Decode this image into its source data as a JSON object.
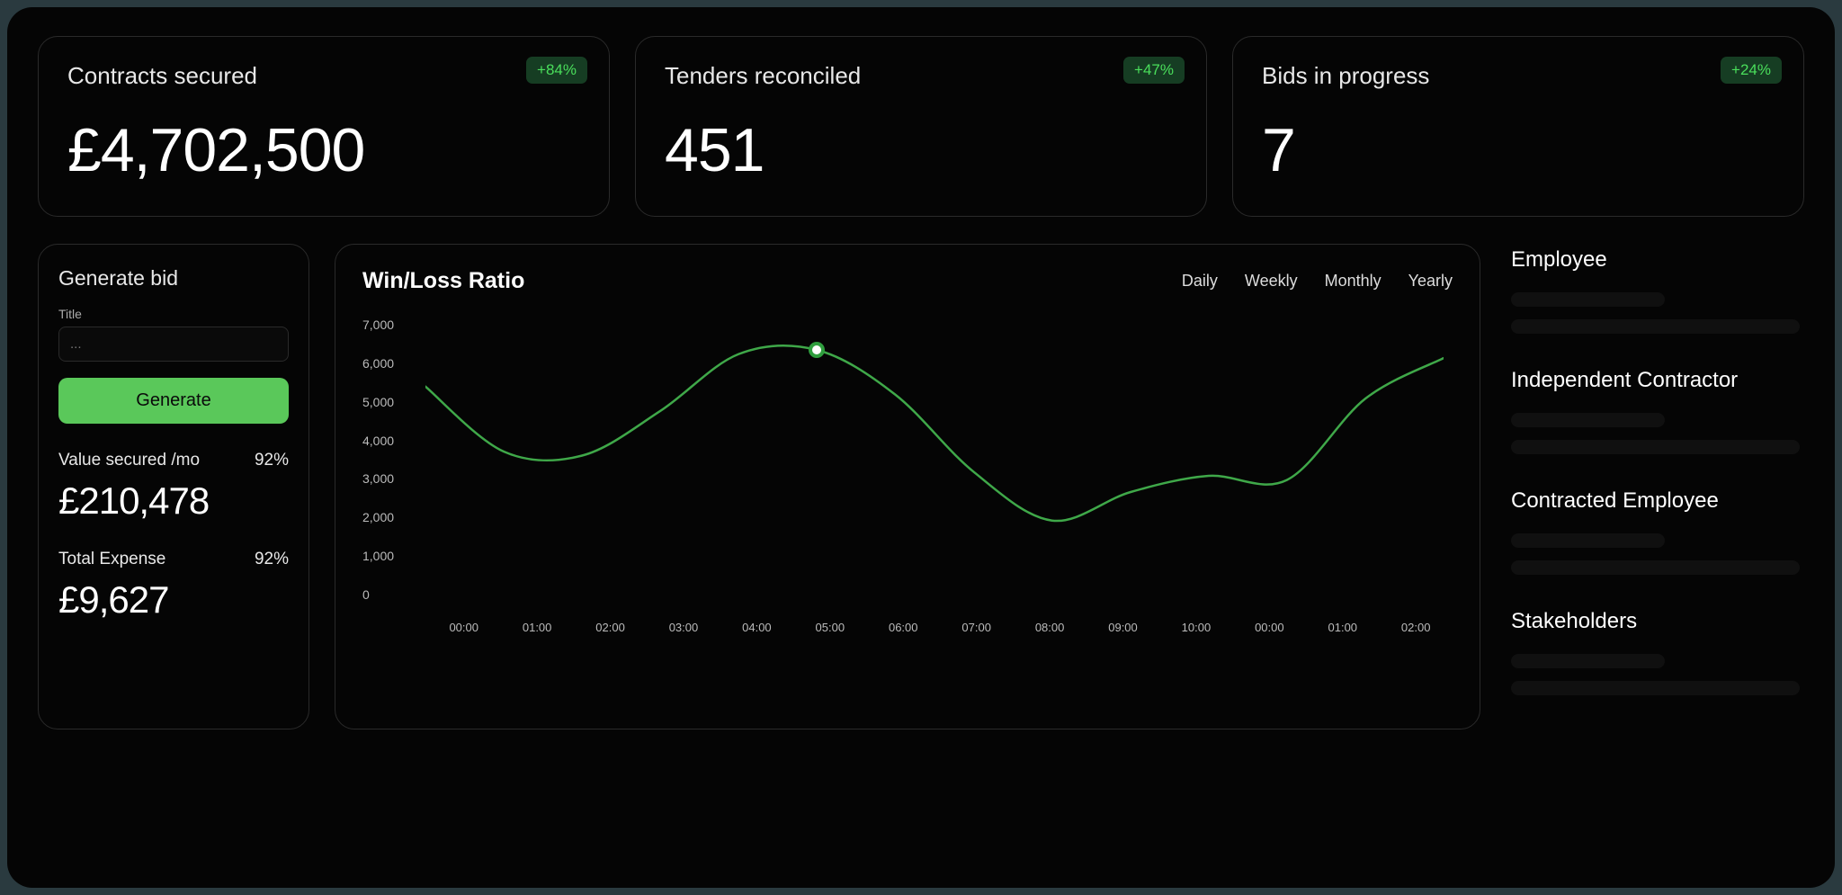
{
  "colors": {
    "accent": "#5ac85a",
    "badge_bg": "#163d23",
    "badge_fg": "#4ade5b"
  },
  "top_cards": [
    {
      "title": "Contracts secured",
      "value": "£4,702,500",
      "delta": "+84%"
    },
    {
      "title": "Tenders reconciled",
      "value": "451",
      "delta": "+47%"
    },
    {
      "title": "Bids in progress",
      "value": "7",
      "delta": "+24%"
    }
  ],
  "generate": {
    "heading": "Generate bid",
    "title_label": "Title",
    "placeholder": "...",
    "button": "Generate",
    "stats": [
      {
        "label": "Value secured /mo",
        "pct": "92%",
        "value": "£210,478"
      },
      {
        "label": "Total Expense",
        "pct": "92%",
        "value": "£9,627"
      }
    ]
  },
  "chart": {
    "title": "Win/Loss Ratio",
    "tabs": [
      "Daily",
      "Weekly",
      "Monthly",
      "Yearly"
    ]
  },
  "chart_data": {
    "type": "line",
    "title": "Win/Loss Ratio",
    "xlabel": "",
    "ylabel": "",
    "ylim": [
      0,
      7000
    ],
    "y_ticks": [
      "7,000",
      "6,000",
      "5,000",
      "4,000",
      "3,000",
      "2,000",
      "1,000",
      "0"
    ],
    "x_ticks": [
      "00:00",
      "01:00",
      "02:00",
      "03:00",
      "04:00",
      "05:00",
      "06:00",
      "07:00",
      "08:00",
      "09:00",
      "10:00",
      "00:00",
      "01:00",
      "02:00"
    ],
    "x": [
      "00:00",
      "01:00",
      "02:00",
      "03:00",
      "04:00",
      "05:00",
      "06:00",
      "07:00",
      "08:00",
      "09:00",
      "10:00",
      "00:00",
      "01:00",
      "02:00"
    ],
    "values": [
      5300,
      3700,
      3600,
      4700,
      6100,
      6200,
      5100,
      3200,
      2000,
      2700,
      3100,
      3000,
      5000,
      6000
    ],
    "marker_index": 5,
    "legend": []
  },
  "side_categories": [
    "Employee",
    "Independent Contractor",
    "Contracted Employee",
    "Stakeholders"
  ]
}
